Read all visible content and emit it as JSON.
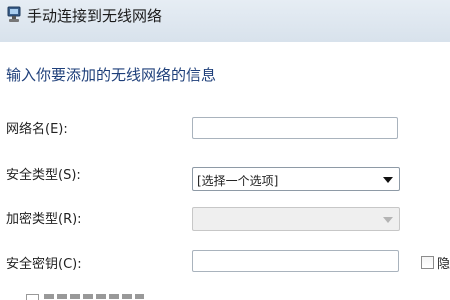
{
  "window": {
    "title": "手动连接到无线网络",
    "icon": "network-icon"
  },
  "main": {
    "heading": "输入你要添加的无线网络的信息",
    "fields": {
      "network_name": {
        "label": "网络名(E):",
        "value": ""
      },
      "security_type": {
        "label": "安全类型(S):",
        "value": "[选择一个选项]"
      },
      "encryption_type": {
        "label": "加密类型(R):",
        "value": ""
      },
      "security_key": {
        "label": "安全密钥(C):",
        "value": ""
      }
    },
    "hide_characters": {
      "label": "隐",
      "checked": false
    }
  },
  "colors": {
    "heading": "#1e3f7a",
    "titlebar": "#dde6ef"
  }
}
